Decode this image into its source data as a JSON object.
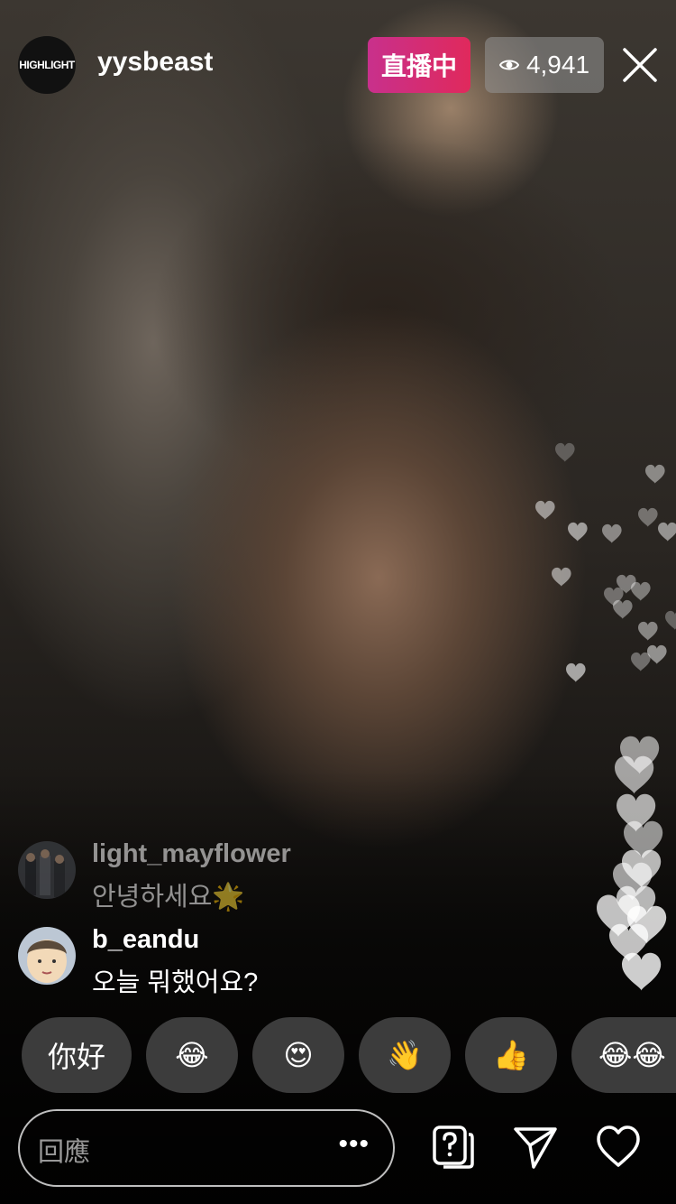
{
  "header": {
    "host_avatar_text": "HIGHLIGHT",
    "host_name": "yysbeast",
    "live_label": "直播中",
    "viewer_count": "4,941"
  },
  "comments": [
    {
      "user": "light_mayflower",
      "text": "안녕하세요🌟"
    },
    {
      "user": "b_eandu",
      "text": "오늘 뭐했어요?"
    }
  ],
  "quick_reactions": [
    "你好",
    "😂",
    "😍",
    "👋",
    "👍",
    "😂😂"
  ],
  "reply": {
    "placeholder": "回應",
    "more": "•••"
  },
  "icons": {
    "close": "close-icon",
    "question": "question-box-icon",
    "send": "paper-plane-icon",
    "like": "heart-icon"
  },
  "colors": {
    "live_gradient_start": "#c8308c",
    "live_gradient_end": "#e0295c"
  }
}
